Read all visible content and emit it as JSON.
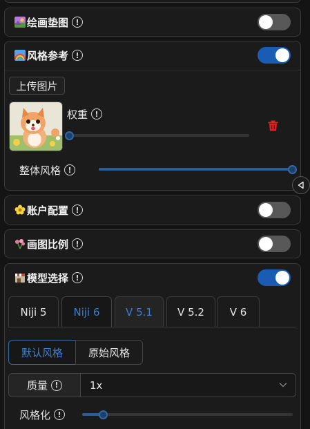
{
  "sections": {
    "drawing_pad": {
      "title": "绘画垫图",
      "enabled": false
    },
    "style_reference": {
      "title": "风格参考",
      "enabled": true,
      "upload_label": "上传图片",
      "weight_label": "权重",
      "weight_value": 0,
      "overall_style_label": "整体风格",
      "overall_style_value": 1
    },
    "account_config": {
      "title": "账户配置",
      "enabled": false
    },
    "aspect_ratio": {
      "title": "画图比例",
      "enabled": false
    },
    "model_select": {
      "title": "模型选择",
      "enabled": true,
      "tabs": [
        "Niji 5",
        "Niji 6",
        "V 5.1",
        "V 5.2",
        "V 6"
      ],
      "active_tab": "Niji 6",
      "style_buttons": [
        "默认风格",
        "原始风格"
      ],
      "active_style": "默认风格",
      "quality_label": "质量",
      "quality_value": "1x",
      "stylize_label": "风格化",
      "stylize_value": 0.1
    }
  },
  "icons": {
    "info": "info-circle-icon",
    "delete": "trash-icon",
    "collapse": "collapse-arrow-icon",
    "dropdown": "chevron-down-icon"
  },
  "colors": {
    "accent": "#1a5bb3",
    "delete": "#e02020"
  }
}
